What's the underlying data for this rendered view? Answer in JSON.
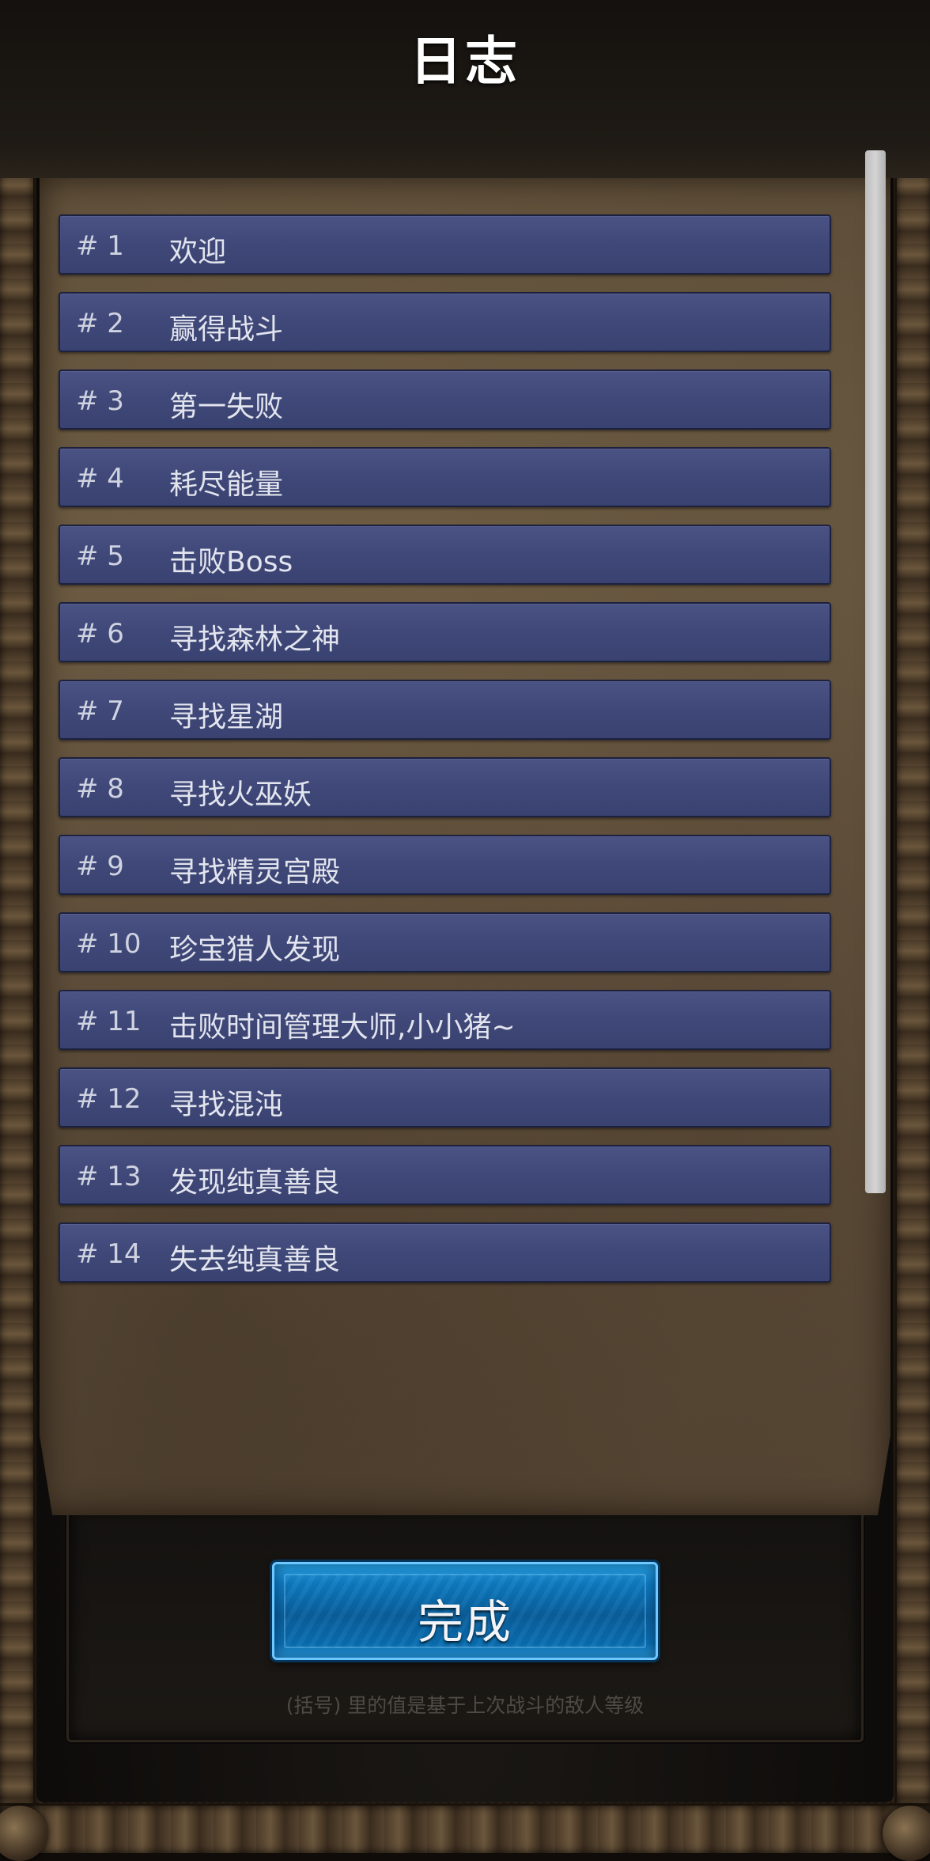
{
  "header": {
    "title": "日志"
  },
  "log_entries": [
    {
      "number": "# 1",
      "title": "欢迎"
    },
    {
      "number": "# 2",
      "title": "赢得战斗"
    },
    {
      "number": "# 3",
      "title": "第一失败"
    },
    {
      "number": "# 4",
      "title": "耗尽能量"
    },
    {
      "number": "# 5",
      "title": "击败Boss"
    },
    {
      "number": "# 6",
      "title": "寻找森林之神"
    },
    {
      "number": "# 7",
      "title": "寻找星湖"
    },
    {
      "number": "# 8",
      "title": "寻找火巫妖"
    },
    {
      "number": "# 9",
      "title": "寻找精灵宫殿"
    },
    {
      "number": "# 10",
      "title": "珍宝猎人发现"
    },
    {
      "number": "# 11",
      "title": "击败时间管理大师,小小猪~"
    },
    {
      "number": "# 12",
      "title": "寻找混沌"
    },
    {
      "number": "# 13",
      "title": "发现纯真善良"
    },
    {
      "number": "# 14",
      "title": "失去纯真善良"
    }
  ],
  "footer": {
    "done_label": "完成",
    "note": "(括号) 里的值是基于上次战斗的敌人等级"
  },
  "colors": {
    "entry_bg": "#3f4878",
    "button_bg": "#0f7cc2",
    "parchment": "#6b5a42",
    "title": "#ffffff"
  }
}
